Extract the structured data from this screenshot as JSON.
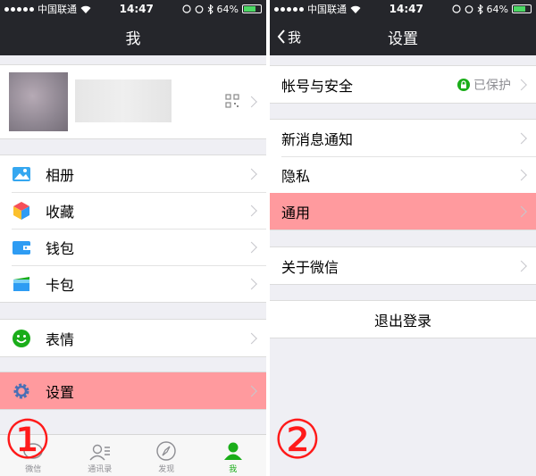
{
  "status_bar": {
    "carrier": "中国联通",
    "time": "14:47",
    "battery": "64%",
    "battery_level": 0.64
  },
  "left": {
    "nav_title": "我",
    "menu_group_1": [
      {
        "label": "相册",
        "icon": "photo-album-icon"
      },
      {
        "label": "收藏",
        "icon": "favorites-cube-icon"
      },
      {
        "label": "钱包",
        "icon": "wallet-icon"
      },
      {
        "label": "卡包",
        "icon": "card-pack-icon"
      }
    ],
    "stickers_label": "表情",
    "settings_label": "设置",
    "step_marker": "①",
    "tabbar": [
      {
        "label": "微信",
        "icon": "chat-icon"
      },
      {
        "label": "通讯录",
        "icon": "contacts-icon"
      },
      {
        "label": "发现",
        "icon": "compass-icon"
      },
      {
        "label": "我",
        "icon": "me-icon"
      }
    ]
  },
  "right": {
    "back_label": "我",
    "nav_title": "设置",
    "account_security": {
      "label": "帐号与安全",
      "status": "已保护"
    },
    "group_2": [
      {
        "label": "新消息通知"
      },
      {
        "label": "隐私"
      },
      {
        "label": "通用"
      }
    ],
    "about_label": "关于微信",
    "logout_label": "退出登录",
    "step_marker": "②"
  },
  "colors": {
    "nav_bg": "#25262b",
    "highlight": "#ff9a9e",
    "wechat_green": "#1aad19",
    "marker_red": "#ff1a1a"
  }
}
